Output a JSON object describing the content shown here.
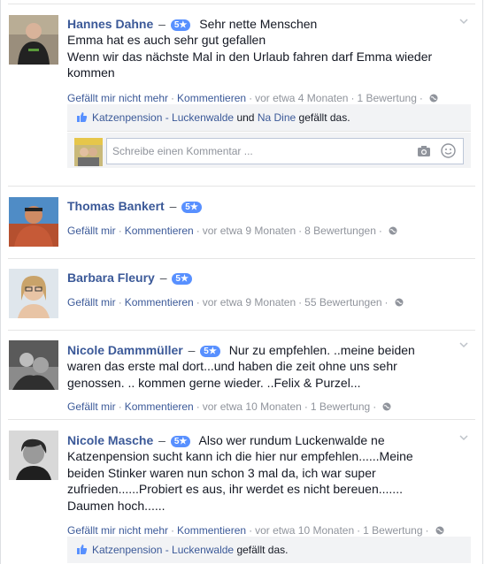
{
  "reviews": [
    {
      "name": "Hannes Dahne",
      "stars": "5★",
      "lines": [
        "Sehr nette Menschen",
        "Emma hat es auch sehr gut gefallen",
        "Wenn wir das nächste Mal in den Urlaub fahren darf Emma wieder",
        "kommen"
      ],
      "like": "Gefällt mir nicht mehr",
      "comment": "Kommentieren",
      "time": "vor etwa 4 Monaten",
      "ratings": "1 Bewertung",
      "liked_by_page": "Katzenpension - Luckenwalde",
      "liked_by_and": "und",
      "liked_by_user": "Na Dine",
      "liked_suffix": "gefällt das.",
      "comment_placeholder": "Schreibe einen Kommentar ..."
    },
    {
      "name": "Thomas Bankert",
      "stars": "5★",
      "like": "Gefällt mir",
      "comment": "Kommentieren",
      "time": "vor etwa 9 Monaten",
      "ratings": "8 Bewertungen"
    },
    {
      "name": "Barbara Fleury",
      "stars": "5★",
      "like": "Gefällt mir",
      "comment": "Kommentieren",
      "time": "vor etwa 9 Monaten",
      "ratings": "55 Bewertungen"
    },
    {
      "name": "Nicole Dammmüller",
      "stars": "5★",
      "lines": [
        "Nur zu empfehlen. ..meine beiden",
        "waren das erste mal dort...und haben die zeit ohne uns sehr",
        "genossen. .. kommen gerne wieder. ..Felix & Purzel..."
      ],
      "like": "Gefällt mir",
      "comment": "Kommentieren",
      "time": "vor etwa 10 Monaten",
      "ratings": "1 Bewertung"
    },
    {
      "name": "Nicole Masche",
      "stars": "5★",
      "lines": [
        "Also wer rundum Luckenwalde ne",
        "Katzenpension sucht kann ich die hier nur empfehlen......Meine",
        "beiden Stinker waren nun schon 3 mal da, ich war super",
        "zufrieden......Probiert es aus, ihr werdet es nicht bereuen.......",
        "Daumen hoch......"
      ],
      "like": "Gefällt mir nicht mehr",
      "comment": "Kommentieren",
      "time": "vor etwa 10 Monaten",
      "ratings": "1 Bewertung",
      "liked_by_page": "Katzenpension - Luckenwalde",
      "liked_suffix": "gefällt das."
    }
  ]
}
